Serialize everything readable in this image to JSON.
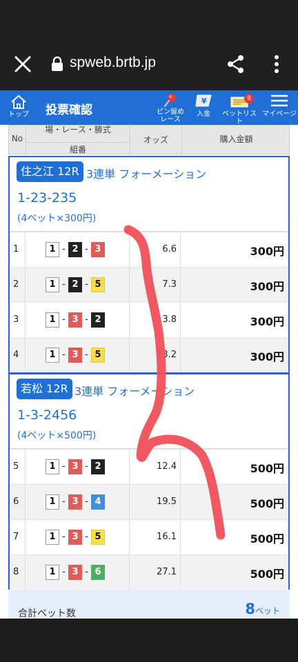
{
  "browser": {
    "url": "spweb.brtb.jp"
  },
  "header": {
    "title": "投票確認",
    "home_label": "トップ",
    "pin_label_1": "ピン留め",
    "pin_label_2": "レース",
    "deposit_label": "入金",
    "betlist_label": "ベットリスト",
    "betlist_badge": "8",
    "mypage_label": "マイページ"
  },
  "table_header": {
    "no": "No",
    "race": "場・レース・勝式",
    "combo": "組番",
    "odds": "オッズ",
    "amount": "購入金額"
  },
  "groups": [
    {
      "venue": "住之江 12R",
      "bet_type": "3連単 フォーメーション",
      "combo": "1-23-235",
      "bet_info": "(4ベット×300円)",
      "rows": [
        {
          "no": "1",
          "picks": [
            "1",
            "2",
            "3"
          ],
          "odds": "6.6",
          "amount": "300円"
        },
        {
          "no": "2",
          "picks": [
            "1",
            "2",
            "5"
          ],
          "odds": "7.3",
          "amount": "300円"
        },
        {
          "no": "3",
          "picks": [
            "1",
            "3",
            "2"
          ],
          "odds": "3.8",
          "amount": "300円"
        },
        {
          "no": "4",
          "picks": [
            "1",
            "3",
            "5"
          ],
          "odds": "13.2",
          "amount": "300円"
        }
      ]
    },
    {
      "venue": "若松 12R",
      "bet_type": "3連単 フォーメーション",
      "combo": "1-3-2456",
      "bet_info": "(4ベット×500円)",
      "rows": [
        {
          "no": "5",
          "picks": [
            "1",
            "3",
            "2"
          ],
          "odds": "12.4",
          "amount": "500円"
        },
        {
          "no": "6",
          "picks": [
            "1",
            "3",
            "4"
          ],
          "odds": "19.5",
          "amount": "500円"
        },
        {
          "no": "7",
          "picks": [
            "1",
            "3",
            "5"
          ],
          "odds": "16.1",
          "amount": "500円"
        },
        {
          "no": "8",
          "picks": [
            "1",
            "3",
            "6"
          ],
          "odds": "27.1",
          "amount": "500円"
        }
      ]
    }
  ],
  "total": {
    "label": "合計ベット数",
    "value": "8",
    "unit": "ベット"
  },
  "colors": {
    "brand_blue": "#1f6fd6",
    "scribble_red": "#f0505a"
  }
}
